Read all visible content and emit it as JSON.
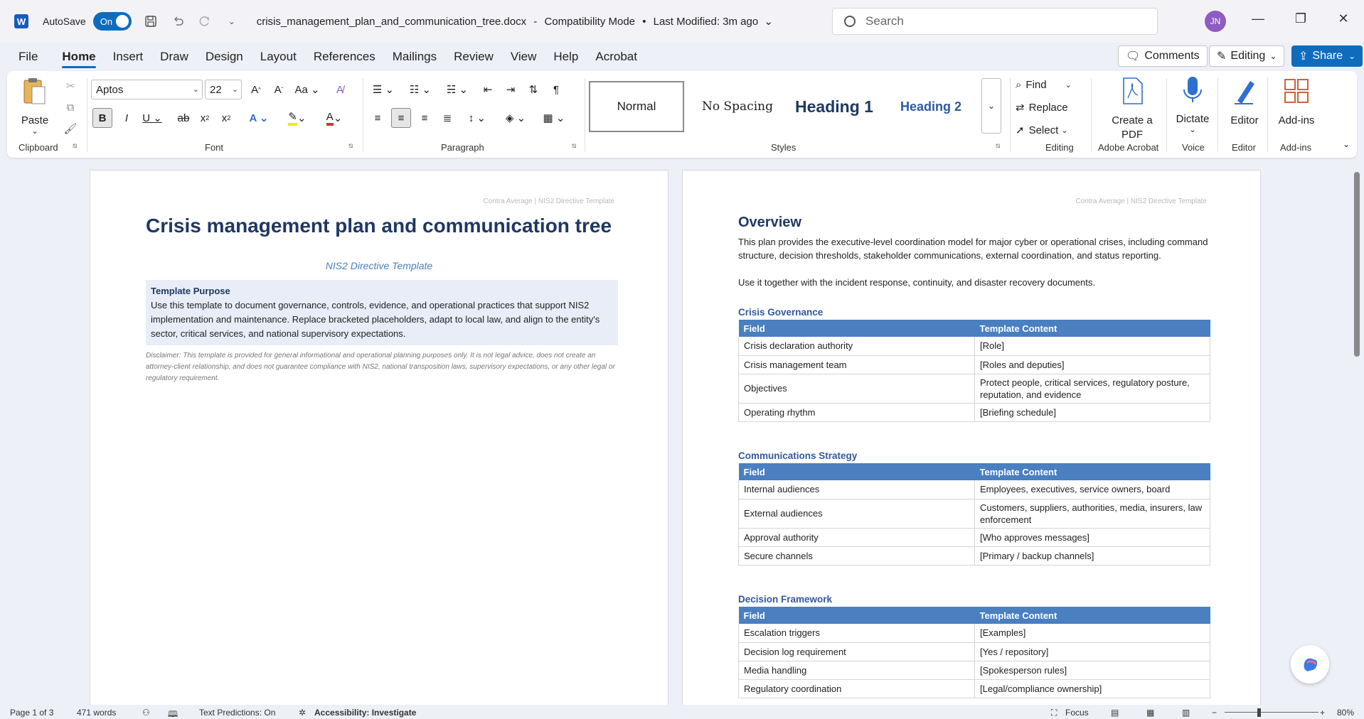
{
  "titlebar": {
    "app_letter": "W",
    "autosave_label": "AutoSave",
    "autosave_state": "On",
    "filename": "crisis_management_plan_and_communication_tree.docx",
    "mode": "Compatibility Mode",
    "separator": "•",
    "last_modified": "Last Modified: 3m ago",
    "search_placeholder": "Search",
    "user_initials": "JN"
  },
  "tabs": [
    "File",
    "Home",
    "Insert",
    "Draw",
    "Design",
    "Layout",
    "References",
    "Mailings",
    "Review",
    "View",
    "Help",
    "Acrobat"
  ],
  "actions": {
    "comments": "Comments",
    "editing": "Editing",
    "share": "Share"
  },
  "ribbon": {
    "clipboard": {
      "label": "Clipboard",
      "paste": "Paste"
    },
    "font": {
      "label": "Font",
      "name": "Aptos",
      "size": "22"
    },
    "paragraph": {
      "label": "Paragraph"
    },
    "styles": {
      "label": "Styles",
      "items": [
        "Normal",
        "No Spacing",
        "Heading 1",
        "Heading 2"
      ]
    },
    "editing": {
      "label": "Editing",
      "find": "Find",
      "replace": "Replace",
      "select": "Select"
    },
    "acrobat": {
      "label": "Adobe Acrobat",
      "button": "Create a PDF"
    },
    "voice": {
      "label": "Voice",
      "button": "Dictate"
    },
    "editor": {
      "label": "Editor",
      "button": "Editor"
    },
    "addins": {
      "label": "Add-ins",
      "button": "Add-ins"
    }
  },
  "page1": {
    "running_head": "Contra Average | NIS2 Directive Template",
    "title": "Crisis management plan and communication tree",
    "subtitle": "NIS2 Directive Template",
    "purpose_title": "Template Purpose",
    "purpose_text": "Use this template to document governance, controls, evidence, and operational practices that support NIS2 implementation and maintenance. Replace bracketed placeholders, adapt to local law, and align to the entity's sector, critical services, and national supervisory expectations.",
    "disclaimer": "Disclaimer: This template is provided for general informational and operational planning purposes only. It is not legal advice, does not create an attorney-client relationship, and does not guarantee compliance with NIS2, national transposition laws, supervisory expectations, or any other legal or regulatory requirement."
  },
  "page2": {
    "running_head": "Contra Average | NIS2 Directive Template",
    "overview_heading": "Overview",
    "overview_p1": "This plan provides the executive-level coordination model for major cyber or operational crises, including command structure, decision thresholds, stakeholder communications, external coordination, and status reporting.",
    "overview_p2": "Use it together with the incident response, continuity, and disaster recovery documents.",
    "col_field": "Field",
    "col_content": "Template Content",
    "sections": [
      {
        "heading": "Crisis Governance",
        "rows": [
          [
            "Crisis declaration authority",
            "[Role]"
          ],
          [
            "Crisis management team",
            "[Roles and deputies]"
          ],
          [
            "Objectives",
            "Protect people, critical services, regulatory posture, reputation, and evidence"
          ],
          [
            "Operating rhythm",
            "[Briefing schedule]"
          ]
        ]
      },
      {
        "heading": "Communications Strategy",
        "rows": [
          [
            "Internal audiences",
            "Employees, executives, service owners, board"
          ],
          [
            "External audiences",
            "Customers, suppliers, authorities, media, insurers, law enforcement"
          ],
          [
            "Approval authority",
            "[Who approves messages]"
          ],
          [
            "Secure channels",
            "[Primary / backup channels]"
          ]
        ]
      },
      {
        "heading": "Decision Framework",
        "rows": [
          [
            "Escalation triggers",
            "[Examples]"
          ],
          [
            "Decision log requirement",
            "[Yes / repository]"
          ],
          [
            "Media handling",
            "[Spokesperson rules]"
          ],
          [
            "Regulatory coordination",
            "[Legal/compliance ownership]"
          ]
        ]
      }
    ]
  },
  "statusbar": {
    "page": "Page 1 of 3",
    "words": "471 words",
    "predictions": "Text Predictions: On",
    "accessibility": "Accessibility: Investigate",
    "focus": "Focus",
    "zoom": "80%"
  },
  "colors": {
    "accent": "#0f6cbd",
    "heading": "#1f3864",
    "table_header": "#4a7fc0"
  }
}
